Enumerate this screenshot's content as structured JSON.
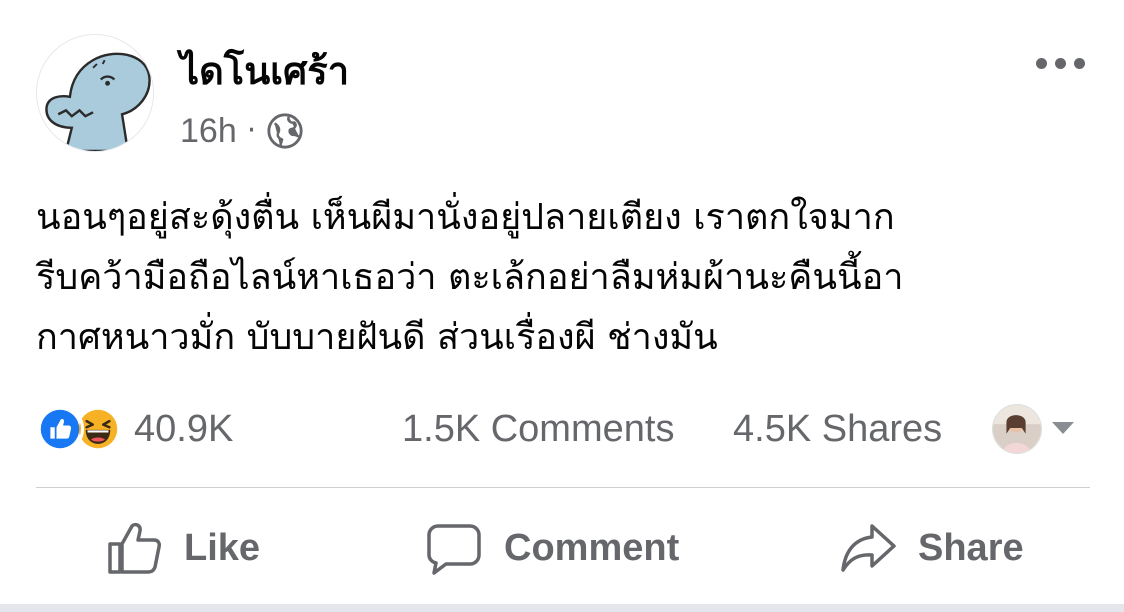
{
  "post": {
    "author": "ไดโนเศร้า",
    "timestamp": "16h",
    "separator": "·",
    "privacy_icon": "globe-icon",
    "menu_icon": "more-options-icon",
    "text_lines": [
      "นอนๆอยู่สะดุ้งตื่น เห็นผีมานั่งอยู่ปลายเตียง เราตกใจมาก",
      "รีบคว้ามือถือไลน์หาเธอว่า ตะเล้กอย่าลืมห่มผ้านะคืนนี้อา",
      "กาศหนาวมั่ก บับบายฝันดี ส่วนเรื่องผี ช่างมัน"
    ]
  },
  "stats": {
    "reaction_icons": [
      "like-reaction-icon",
      "haha-reaction-icon"
    ],
    "reaction_count": "40.9K",
    "comments": "1.5K Comments",
    "shares": "4.5K Shares"
  },
  "actions": {
    "like": "Like",
    "comment": "Comment",
    "share": "Share"
  },
  "colors": {
    "like_blue": "#1877f2",
    "haha_yellow": "#f7b125",
    "secondary_text": "#65676b",
    "avatar_dino": "#a9cbdc"
  }
}
